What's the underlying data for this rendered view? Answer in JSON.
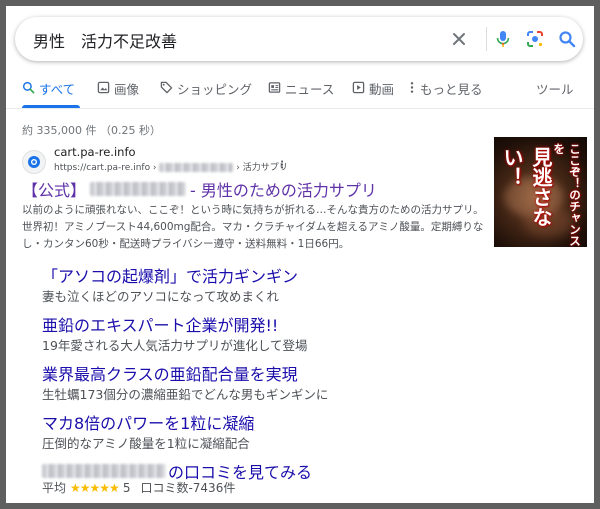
{
  "search": {
    "query": "男性　活力不足改善"
  },
  "tabs": [
    {
      "label": "すべて",
      "icon": "search-icon",
      "active": true
    },
    {
      "label": "画像",
      "icon": "image-icon"
    },
    {
      "label": "ショッピング",
      "icon": "tag-icon"
    },
    {
      "label": "ニュース",
      "icon": "news-icon"
    },
    {
      "label": "動画",
      "icon": "video-icon"
    },
    {
      "label": "もっと見る",
      "icon": "more-vert-icon"
    },
    {
      "label": "ツール"
    }
  ],
  "result_count": "約 335,000 件 （0.25 秒）",
  "ad": {
    "site_name": "cart.pa-re.info",
    "url_prefix": "https://cart.pa-re.info › ",
    "url_suffix": " › 活力サプリ",
    "menu_glyph": "⋮",
    "title_prefix": "【公式】",
    "title_suffix": "- 男性のための活力サプリ",
    "description": "以前のように頑張れない、ここぞ！という時に気持ちが折れる…そんな貴方のための活力サプリ。世界初！アミノブースト44,600mg配合。マカ・クラチャイダムを超えるアミノ酸量。定期縛りなし・カンタン60秒・配送時プライバシー遵守・送料無料・1日66円。",
    "thumbnail_text_1": "ここぞ！のチャンスを",
    "thumbnail_text_2": "見逃さない！"
  },
  "sitelinks": [
    {
      "title": "「アソコの起爆剤」で活力ギンギン",
      "desc": "妻も泣くほどのアソコになって攻めまくれ"
    },
    {
      "title": "亜鉛のエキスパート企業が開発!!",
      "desc": "19年愛される大人気活力サプリが進化して登場"
    },
    {
      "title": "業界最高クラスの亜鉛配合量を実現",
      "desc": "生牡蠣173個分の濃縮亜鉛でどんな男もギンギンに"
    },
    {
      "title": "マカ8倍のパワーを1粒に凝縮",
      "desc": "圧倒的なアミノ酸量を1粒に凝縮配合"
    }
  ],
  "review_link": {
    "title_suffix": "の口コミを見てみる",
    "rating_label": "平均",
    "stars": "★★★★★",
    "rating_value": "5",
    "review_count": "口コミ数-7436件"
  },
  "colors": {
    "link": "#1a0dab",
    "visited": "#5f32a8",
    "accent": "#1a73e8",
    "stars": "#fbbc04"
  }
}
